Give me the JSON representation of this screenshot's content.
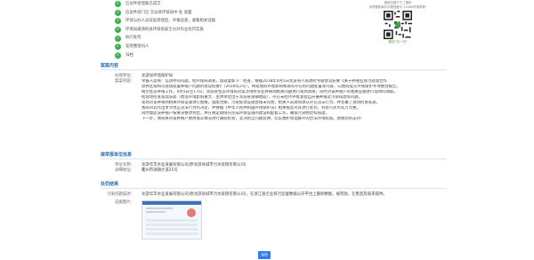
{
  "steps": [
    "信访件受理备已成交",
    "信访件部门已 交派县环保局中 处 放置",
    "环保与办人员双层受理后，举报盐查，收集相关证据",
    "环境局邀请的县环保保安全分开作业处罚实施",
    "执行处罚",
    "案卷整理归人",
    "归档"
  ],
  "qr": {
    "caption_line1": "微信扫描下方二维码",
    "caption_line2": "实时跟踪事件办理进度与\"12369环保举报\"",
    "hint": "微信\"扫一扫\""
  },
  "case": {
    "title": "案案内容",
    "unit_label": "办理单位：",
    "unit_value": "龙游县环境保护局",
    "content_label": "案案内容：",
    "content_lines": [
      "举报人反映：信访件的问题，经环保局调查，现就复如下：经查，根据2018年4月5日龙游县人民政府专题会议纪要《关于养殖业粪污处理合作",
      "禁养区域和可处理处置养殖户问题的会议纪要》（2018年2号），将处理的环境影响和现有存在的问题处置等内容，向我局提交环境保护专项整治报告，",
      "规范生态养殖工作，4月5日至17日，龙游县生态环境局对案涉场所农业养殖场相关问题进行现场调查，同时对该养殖户的相关证据进行现场的调取，",
      "经现场检查发现该处（地址环境影响重大、主体单位位于龙游县湖镇地段），存在未经环评批准擅自开展养殖及污染排放等问题，",
      "现场对该养殖场相关环保设施进行勘察，固废台账、污染处理设施台账未完善，相关人员现场承认存在违法行为，并签署了现场检查笔录，",
      "我局对其作出责令改正违法行为的决定，并依据《中华人民共和国环境保护法》相关规定对其进行处罚，罚款人民币贰万元整，",
      "同时督促该养殖户按要求整改到位，并在规定期限内完成环保设施的建设和配套工作，确保污染物达标排放，",
      "下一步，我局将对该养殖户整改落实情况进行跟踪检查，坚决防止问题反弹，切实维护周边群众的合法环境权益。感谢您的支持！"
    ]
  },
  "org": {
    "title": "接举报单位信息",
    "unit_label": "单位名称：",
    "unit_value": "龙游华丰水业发展有限公司(原龙游县城市污水处理有限公司)",
    "address_label": "详细地址：",
    "address_value": "衢州市湖镇大道25号"
  },
  "result": {
    "title": "处罚结果",
    "summary_label": "污染问题描述：",
    "summary_value": "龙游华丰水业发展有限公司(原龙游县城市污水处理有限公司)，在浙江省企业排污监督数据公开平台上删除数据，被罚款，在售后及值来提供。",
    "image_label": "证据图片："
  },
  "return_label": "返回"
}
